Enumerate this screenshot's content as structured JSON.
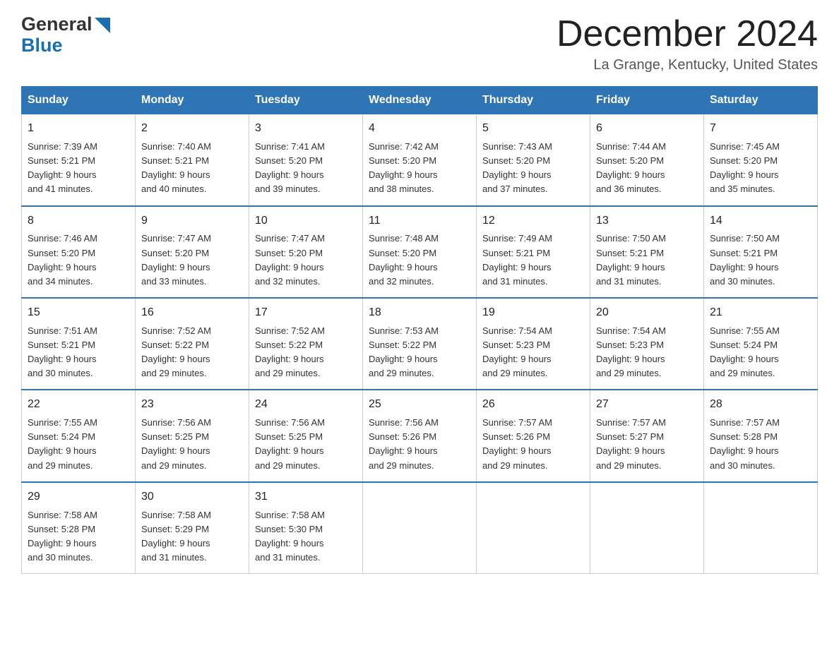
{
  "logo": {
    "general": "General",
    "blue": "Blue"
  },
  "title": {
    "month_year": "December 2024",
    "location": "La Grange, Kentucky, United States"
  },
  "headers": [
    "Sunday",
    "Monday",
    "Tuesday",
    "Wednesday",
    "Thursday",
    "Friday",
    "Saturday"
  ],
  "weeks": [
    [
      {
        "day": "1",
        "sunrise": "7:39 AM",
        "sunset": "5:21 PM",
        "daylight": "9 hours and 41 minutes."
      },
      {
        "day": "2",
        "sunrise": "7:40 AM",
        "sunset": "5:21 PM",
        "daylight": "9 hours and 40 minutes."
      },
      {
        "day": "3",
        "sunrise": "7:41 AM",
        "sunset": "5:20 PM",
        "daylight": "9 hours and 39 minutes."
      },
      {
        "day": "4",
        "sunrise": "7:42 AM",
        "sunset": "5:20 PM",
        "daylight": "9 hours and 38 minutes."
      },
      {
        "day": "5",
        "sunrise": "7:43 AM",
        "sunset": "5:20 PM",
        "daylight": "9 hours and 37 minutes."
      },
      {
        "day": "6",
        "sunrise": "7:44 AM",
        "sunset": "5:20 PM",
        "daylight": "9 hours and 36 minutes."
      },
      {
        "day": "7",
        "sunrise": "7:45 AM",
        "sunset": "5:20 PM",
        "daylight": "9 hours and 35 minutes."
      }
    ],
    [
      {
        "day": "8",
        "sunrise": "7:46 AM",
        "sunset": "5:20 PM",
        "daylight": "9 hours and 34 minutes."
      },
      {
        "day": "9",
        "sunrise": "7:47 AM",
        "sunset": "5:20 PM",
        "daylight": "9 hours and 33 minutes."
      },
      {
        "day": "10",
        "sunrise": "7:47 AM",
        "sunset": "5:20 PM",
        "daylight": "9 hours and 32 minutes."
      },
      {
        "day": "11",
        "sunrise": "7:48 AM",
        "sunset": "5:20 PM",
        "daylight": "9 hours and 32 minutes."
      },
      {
        "day": "12",
        "sunrise": "7:49 AM",
        "sunset": "5:21 PM",
        "daylight": "9 hours and 31 minutes."
      },
      {
        "day": "13",
        "sunrise": "7:50 AM",
        "sunset": "5:21 PM",
        "daylight": "9 hours and 31 minutes."
      },
      {
        "day": "14",
        "sunrise": "7:50 AM",
        "sunset": "5:21 PM",
        "daylight": "9 hours and 30 minutes."
      }
    ],
    [
      {
        "day": "15",
        "sunrise": "7:51 AM",
        "sunset": "5:21 PM",
        "daylight": "9 hours and 30 minutes."
      },
      {
        "day": "16",
        "sunrise": "7:52 AM",
        "sunset": "5:22 PM",
        "daylight": "9 hours and 29 minutes."
      },
      {
        "day": "17",
        "sunrise": "7:52 AM",
        "sunset": "5:22 PM",
        "daylight": "9 hours and 29 minutes."
      },
      {
        "day": "18",
        "sunrise": "7:53 AM",
        "sunset": "5:22 PM",
        "daylight": "9 hours and 29 minutes."
      },
      {
        "day": "19",
        "sunrise": "7:54 AM",
        "sunset": "5:23 PM",
        "daylight": "9 hours and 29 minutes."
      },
      {
        "day": "20",
        "sunrise": "7:54 AM",
        "sunset": "5:23 PM",
        "daylight": "9 hours and 29 minutes."
      },
      {
        "day": "21",
        "sunrise": "7:55 AM",
        "sunset": "5:24 PM",
        "daylight": "9 hours and 29 minutes."
      }
    ],
    [
      {
        "day": "22",
        "sunrise": "7:55 AM",
        "sunset": "5:24 PM",
        "daylight": "9 hours and 29 minutes."
      },
      {
        "day": "23",
        "sunrise": "7:56 AM",
        "sunset": "5:25 PM",
        "daylight": "9 hours and 29 minutes."
      },
      {
        "day": "24",
        "sunrise": "7:56 AM",
        "sunset": "5:25 PM",
        "daylight": "9 hours and 29 minutes."
      },
      {
        "day": "25",
        "sunrise": "7:56 AM",
        "sunset": "5:26 PM",
        "daylight": "9 hours and 29 minutes."
      },
      {
        "day": "26",
        "sunrise": "7:57 AM",
        "sunset": "5:26 PM",
        "daylight": "9 hours and 29 minutes."
      },
      {
        "day": "27",
        "sunrise": "7:57 AM",
        "sunset": "5:27 PM",
        "daylight": "9 hours and 29 minutes."
      },
      {
        "day": "28",
        "sunrise": "7:57 AM",
        "sunset": "5:28 PM",
        "daylight": "9 hours and 30 minutes."
      }
    ],
    [
      {
        "day": "29",
        "sunrise": "7:58 AM",
        "sunset": "5:28 PM",
        "daylight": "9 hours and 30 minutes."
      },
      {
        "day": "30",
        "sunrise": "7:58 AM",
        "sunset": "5:29 PM",
        "daylight": "9 hours and 31 minutes."
      },
      {
        "day": "31",
        "sunrise": "7:58 AM",
        "sunset": "5:30 PM",
        "daylight": "9 hours and 31 minutes."
      },
      null,
      null,
      null,
      null
    ]
  ],
  "labels": {
    "sunrise": "Sunrise:",
    "sunset": "Sunset:",
    "daylight": "Daylight:"
  }
}
